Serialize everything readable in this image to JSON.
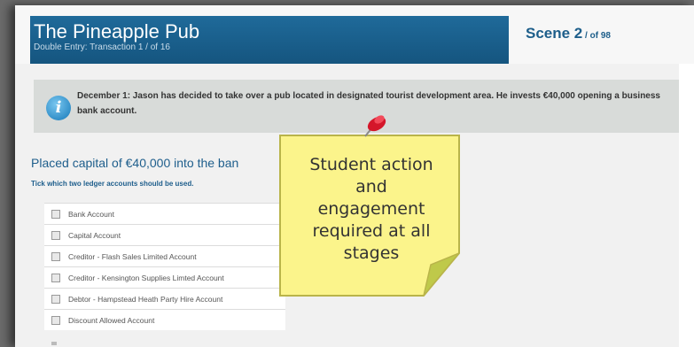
{
  "header": {
    "title": "The Pineapple Pub",
    "subtitle": "Double Entry: Transaction 1 / of 16",
    "scene_label": "Scene 2",
    "scene_of": " / of 98"
  },
  "info": {
    "icon": "info-icon",
    "text": "December 1: Jason has decided to take over a pub located in designated tourist development area. He invests €40,000 opening a business bank account."
  },
  "question": {
    "heading": "Placed capital of €40,000 into the ban",
    "instruction": "Tick which two ledger accounts should be used."
  },
  "ledger_accounts": [
    {
      "label": "Bank Account"
    },
    {
      "label": "Capital Account"
    },
    {
      "label": "Creditor - Flash Sales Limited Account"
    },
    {
      "label": "Creditor - Kensington Supplies Limted Account"
    },
    {
      "label": "Debtor - Hampstead Heath Party Hire Account"
    },
    {
      "label": "Discount Allowed Account"
    }
  ],
  "note": {
    "text": "Student action and engagement required  at all stages",
    "icon": "push-pin-icon",
    "color": "#fbf48b"
  }
}
